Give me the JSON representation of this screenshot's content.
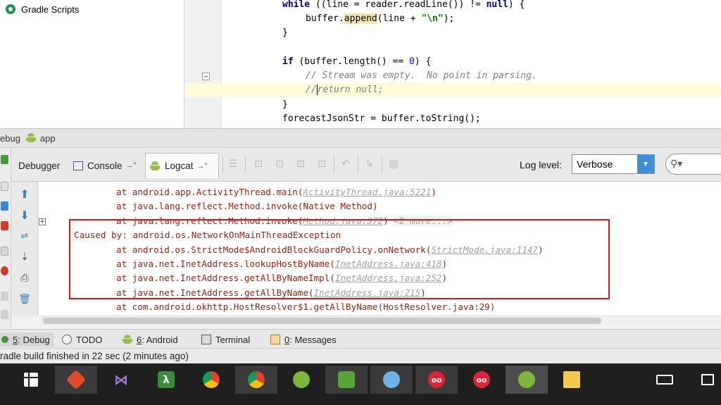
{
  "project": {
    "gradle_scripts": "Gradle Scripts"
  },
  "editor": {
    "lines": [
      {
        "indent": "",
        "parts": [
          {
            "t": "while",
            "c": "kw"
          },
          {
            "t": " ((line = reader.readLine()) != "
          },
          {
            "t": "null",
            "c": "kw"
          },
          {
            "t": ") {"
          }
        ]
      },
      {
        "indent": "    ",
        "parts": [
          {
            "t": "buffer."
          },
          {
            "t": "append",
            "c": "mth"
          },
          {
            "t": "(line + "
          },
          {
            "t": "\"\\n\"",
            "c": "str"
          },
          {
            "t": ");"
          }
        ]
      },
      {
        "indent": "",
        "parts": [
          {
            "t": "}"
          }
        ]
      },
      {
        "indent": "",
        "parts": []
      },
      {
        "indent": "",
        "parts": [
          {
            "t": "if",
            "c": "kw"
          },
          {
            "t": " (buffer.length() == "
          },
          {
            "t": "0",
            "c": "num"
          },
          {
            "t": ") {"
          }
        ]
      },
      {
        "indent": "    ",
        "parts": [
          {
            "t": "// Stream was empty.  No point in parsing.",
            "c": "cmt"
          }
        ]
      },
      {
        "indent": "    ",
        "parts": [
          {
            "t": "//",
            "c": "cmt"
          },
          {
            "t": "|",
            "c": "caret"
          },
          {
            "t": "return null;",
            "c": "cmt"
          }
        ]
      },
      {
        "indent": "",
        "parts": [
          {
            "t": "}"
          }
        ]
      },
      {
        "indent": "",
        "parts": [
          {
            "t": "forecastJsonStr = buffer.toString();"
          }
        ]
      }
    ]
  },
  "debug_header": {
    "prefix": "ebug",
    "config": "app"
  },
  "tabs": {
    "debugger": "Debugger",
    "console": "Console",
    "logcat": "Logcat",
    "pin": "→″"
  },
  "loglevel": {
    "label": "Log level:",
    "value": "Verbose"
  },
  "logcat": {
    "lines": [
      {
        "indent": "        ",
        "parts": [
          {
            "t": "at android.app.ActivityThread.main("
          },
          {
            "t": "ActivityThread.java:5221",
            "c": "lnk"
          },
          {
            "t": ")"
          }
        ]
      },
      {
        "indent": "        ",
        "parts": [
          {
            "t": "at java.lang.reflect.Method.invoke(Native Method)"
          }
        ]
      },
      {
        "indent": "        ",
        "parts": [
          {
            "t": "at java.lang.reflect.Method.invoke("
          },
          {
            "t": "Method.java:372",
            "c": "lnk"
          },
          {
            "t": ") "
          },
          {
            "t": "<2 more...>",
            "c": "more"
          }
        ]
      },
      {
        "indent": "",
        "parts": [
          {
            "t": "Caused by: android.os.NetworkOnMainThreadException"
          }
        ]
      },
      {
        "indent": "        ",
        "parts": [
          {
            "t": "at android.os.StrictMode$AndroidBlockGuardPolicy.onNetwork("
          },
          {
            "t": "StrictMode.java:1147",
            "c": "lnk"
          },
          {
            "t": ")"
          }
        ]
      },
      {
        "indent": "        ",
        "parts": [
          {
            "t": "at java.net.InetAddress.lookupHostByName("
          },
          {
            "t": "InetAddress.java:418",
            "c": "lnk"
          },
          {
            "t": ")"
          }
        ]
      },
      {
        "indent": "        ",
        "parts": [
          {
            "t": "at java.net.InetAddress.getAllByNameImpl("
          },
          {
            "t": "InetAddress.java:252",
            "c": "lnk"
          },
          {
            "t": ")"
          }
        ]
      },
      {
        "indent": "        ",
        "parts": [
          {
            "t": "at java.net.InetAddress.getAllByName("
          },
          {
            "t": "InetAddress.java:215",
            "c": "lnk"
          },
          {
            "t": ")"
          }
        ]
      },
      {
        "indent": "        ",
        "parts": [
          {
            "t": "at com.android.okhttp.HostResolver$1.getAllByName(HostResolver.java:29)"
          }
        ]
      }
    ]
  },
  "bottom_tabs": {
    "debug_num": "5",
    "debug_label": ": Debug",
    "todo": "TODO",
    "android_num": "6",
    "android_label": ": Android",
    "terminal": "Terminal",
    "messages_num": "0",
    "messages_label": ": Messages"
  },
  "status": {
    "text": "radle build finished in 22 sec (2 minutes ago)"
  },
  "colors": {
    "error_text": "#9c1f0f",
    "highlight_border": "#e01515",
    "accent": "#3d8fd8"
  }
}
